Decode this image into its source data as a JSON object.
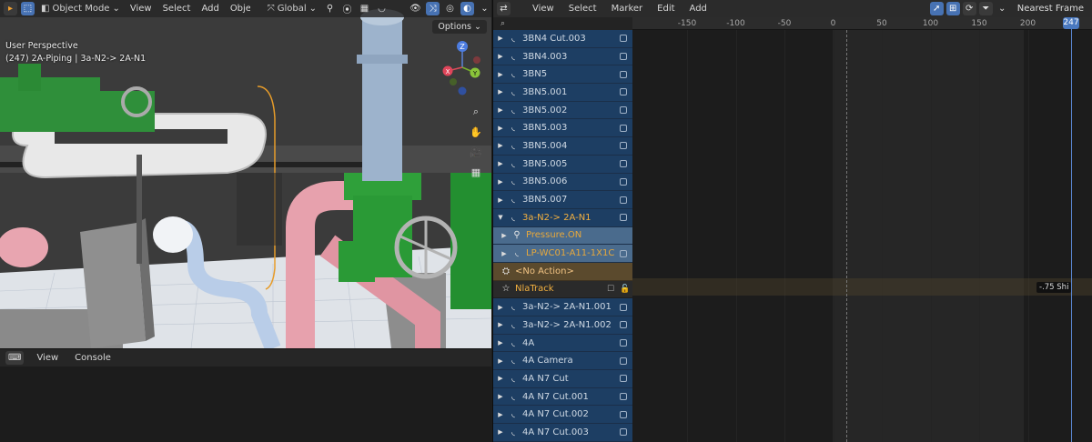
{
  "viewport": {
    "header": {
      "mode": "Object Mode",
      "menus": [
        "View",
        "Select",
        "Add",
        "Object"
      ],
      "transform": "Global"
    },
    "info_line1": "User Perspective",
    "info_line2": "(247) 2A-Piping | 3a-N2-> 2A-N1",
    "options_label": "Options",
    "gizmo": {
      "z": "Z",
      "x": "X",
      "y": "Y"
    }
  },
  "console": {
    "menus": [
      "View",
      "Console"
    ]
  },
  "nla": {
    "menus": [
      "View",
      "Select",
      "Marker",
      "Edit",
      "Add"
    ],
    "snap": "Nearest Frame",
    "search_icon": "search-icon",
    "channels": [
      {
        "label": "3BN4 Cut.003",
        "kind": "object",
        "expanded": false
      },
      {
        "label": "3BN4.003",
        "kind": "object",
        "expanded": false
      },
      {
        "label": "3BN5",
        "kind": "object",
        "expanded": false
      },
      {
        "label": "3BN5.001",
        "kind": "object",
        "expanded": false
      },
      {
        "label": "3BN5.002",
        "kind": "object",
        "expanded": false
      },
      {
        "label": "3BN5.003",
        "kind": "object",
        "expanded": false
      },
      {
        "label": "3BN5.004",
        "kind": "object",
        "expanded": false
      },
      {
        "label": "3BN5.005",
        "kind": "object",
        "expanded": false
      },
      {
        "label": "3BN5.006",
        "kind": "object",
        "expanded": false
      },
      {
        "label": "3BN5.007",
        "kind": "object",
        "expanded": false
      },
      {
        "label": "3a-N2-> 2A-N1",
        "kind": "object-active",
        "expanded": true
      },
      {
        "label": "Pressure.ON",
        "kind": "sub"
      },
      {
        "label": "LP-WC01-A11-1X1C",
        "kind": "sub2"
      },
      {
        "label": "<No Action>",
        "kind": "action"
      },
      {
        "label": "NlaTrack",
        "kind": "track"
      },
      {
        "label": "3a-N2-> 2A-N1.001",
        "kind": "object",
        "expanded": false
      },
      {
        "label": "3a-N2-> 2A-N1.002",
        "kind": "object",
        "expanded": false
      },
      {
        "label": "4A",
        "kind": "object",
        "expanded": false
      },
      {
        "label": "4A Camera",
        "kind": "object",
        "expanded": false
      },
      {
        "label": "4A N7 Cut",
        "kind": "object",
        "expanded": false
      },
      {
        "label": "4A N7 Cut.001",
        "kind": "object",
        "expanded": false
      },
      {
        "label": "4A N7 Cut.002",
        "kind": "object",
        "expanded": false
      },
      {
        "label": "4A N7 Cut.003",
        "kind": "object",
        "expanded": false
      }
    ],
    "timeline": {
      "ticks": [
        "-150",
        "-100",
        "-50",
        "0",
        "50",
        "100",
        "150",
        "200"
      ],
      "current_frame": "247",
      "shift_label": "-.75 Shi"
    }
  },
  "colors": {
    "accent": "#4772b3",
    "channel_blue": "#1d3e63",
    "active_orange": "#f2b040"
  }
}
